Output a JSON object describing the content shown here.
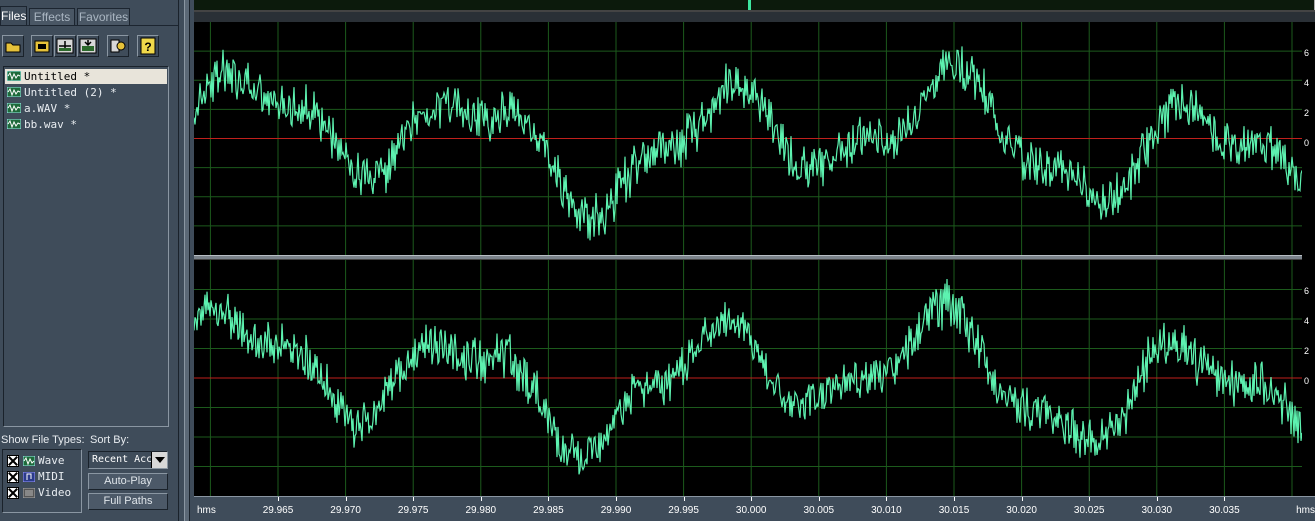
{
  "tabs": [
    {
      "label": "Files",
      "active": true
    },
    {
      "label": "Effects",
      "active": false
    },
    {
      "label": "Favorites",
      "active": false
    }
  ],
  "toolbar": [
    {
      "icon": "open-folder-icon"
    },
    {
      "icon": "close-file-icon"
    },
    {
      "icon": "insert-into-multitrack-icon"
    },
    {
      "icon": "edit-file-icon"
    },
    {
      "icon": "sort-settings-icon"
    },
    {
      "icon": "help-icon"
    }
  ],
  "files": [
    {
      "name": "Untitled *",
      "selected": true
    },
    {
      "name": "Untitled (2) *",
      "selected": false
    },
    {
      "name": "a.WAV *",
      "selected": false
    },
    {
      "name": "bb.wav *",
      "selected": false
    }
  ],
  "show_file_types": {
    "label": "Show File Types:",
    "types": [
      {
        "label": "Wave",
        "checked": true
      },
      {
        "label": "MIDI",
        "checked": true
      },
      {
        "label": "Video",
        "checked": true
      }
    ]
  },
  "sort": {
    "label": "Sort By:",
    "value": "Recent Acc"
  },
  "buttons": {
    "auto_play": "Auto-Play",
    "full_paths": "Full Paths"
  },
  "ruler": {
    "left_unit": "hms",
    "right_unit": "hms",
    "ticks": [
      "29.965",
      "29.970",
      "29.975",
      "29.980",
      "29.985",
      "29.990",
      "29.995",
      "30.000",
      "30.005",
      "30.010",
      "30.015",
      "30.020",
      "30.025",
      "30.030",
      "30.035"
    ]
  },
  "scale_labels": [
    "6",
    "4",
    "2",
    "0",
    "2",
    "4",
    "6"
  ],
  "colors": {
    "waveform": "#5df2b0",
    "grid": "#1c5a1c",
    "center_line": "#c0201c",
    "panel": "#3f4c5a"
  }
}
